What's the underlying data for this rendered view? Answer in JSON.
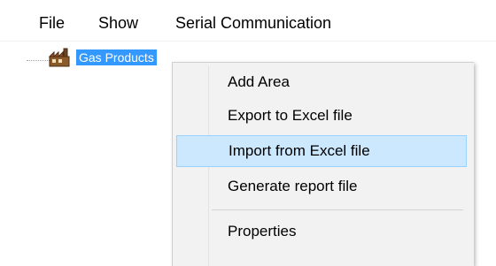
{
  "menubar": {
    "items": [
      {
        "label": "File"
      },
      {
        "label": "Show"
      },
      {
        "label": "Serial Communication"
      }
    ]
  },
  "tree": {
    "root": {
      "label": "Gas Products",
      "icon": "factory-icon",
      "selected": true
    }
  },
  "context_menu": {
    "items": [
      {
        "label": "Add Area"
      },
      {
        "label": "Export to Excel file"
      },
      {
        "label": "Import from Excel file",
        "highlighted": true
      },
      {
        "label": "Generate report file"
      },
      {
        "label": "Properties"
      }
    ]
  },
  "colors": {
    "selection": "#3399ff",
    "menu_background": "#f2f2f2",
    "menu_hover": "#cce8ff",
    "menu_hover_border": "#99d1ff"
  }
}
